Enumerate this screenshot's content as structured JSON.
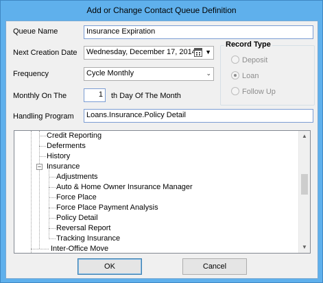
{
  "window": {
    "title": "Add or Change Contact Queue Definition"
  },
  "form": {
    "queue_name_label": "Queue Name",
    "queue_name_value": "Insurance Expiration",
    "next_creation_label": "Next Creation Date",
    "next_creation_value": "Wednesday, December 17, 2014",
    "frequency_label": "Frequency",
    "frequency_value": "Cycle Monthly",
    "monthly_on_label": "Monthly On The",
    "monthly_on_value": "1",
    "monthly_suffix": "th Day Of The Month",
    "handling_label": "Handling Program",
    "handling_value": "Loans.Insurance.Policy Detail"
  },
  "record_type": {
    "title": "Record Type",
    "options": [
      "Deposit",
      "Loan",
      "Follow Up"
    ],
    "selected": "Loan"
  },
  "tree": {
    "items": [
      {
        "label": "Credit Reporting",
        "level": 1
      },
      {
        "label": "Deferments",
        "level": 1
      },
      {
        "label": "History",
        "level": 1
      },
      {
        "label": "Insurance",
        "level": 1,
        "expanded": true
      },
      {
        "label": "Adjustments",
        "level": 2
      },
      {
        "label": "Auto & Home Owner Insurance Manager",
        "level": 2
      },
      {
        "label": "Force Place",
        "level": 2
      },
      {
        "label": "Force Place Payment Analysis",
        "level": 2
      },
      {
        "label": "Policy Detail",
        "level": 2
      },
      {
        "label": "Reversal Report",
        "level": 2
      },
      {
        "label": "Tracking Insurance",
        "level": 2
      },
      {
        "label": "Inter-Office Move",
        "level": 0
      }
    ]
  },
  "buttons": {
    "ok_label": "OK",
    "cancel_label": "Cancel"
  }
}
